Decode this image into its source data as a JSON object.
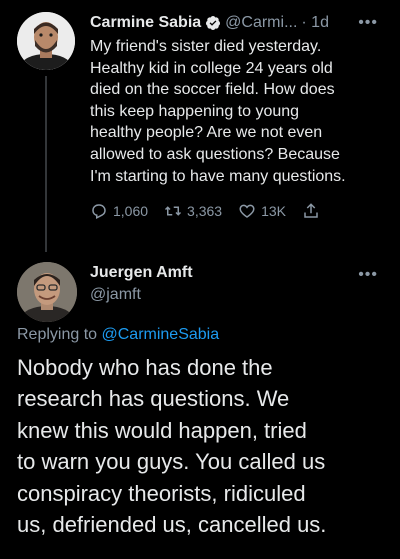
{
  "colors": {
    "background": "#000000",
    "text": "#e7e9ea",
    "muted": "#8b98a5",
    "link": "#1d9bf0",
    "verified": "#1d9bf0"
  },
  "tweet1": {
    "author_name": "Carmine Sabia",
    "handle": "@Carmi...",
    "time": "· 1d",
    "more_icon": "more-icon",
    "body_lines": [
      "My friend's sister died yesterday.",
      "Healthy kid in college 24 years old",
      "died on the soccer field. How does",
      "this keep happening to young",
      "healthy people? Are we not even",
      "allowed to ask questions? Because",
      "I'm starting to have many questions."
    ],
    "replies": "1,060",
    "retweets": "3,363",
    "likes": "13K"
  },
  "tweet2": {
    "author_name": "Juergen Amft",
    "handle": "@jamft",
    "replying_label": "Replying to",
    "replying_to": "@CarmineSabia",
    "body_lines": [
      "Nobody who has done the",
      "research has questions. We",
      "knew this would happen, tried",
      "to warn you guys. You called us",
      "conspiracy theorists, ridiculed",
      "us, defriended us, cancelled us."
    ]
  }
}
